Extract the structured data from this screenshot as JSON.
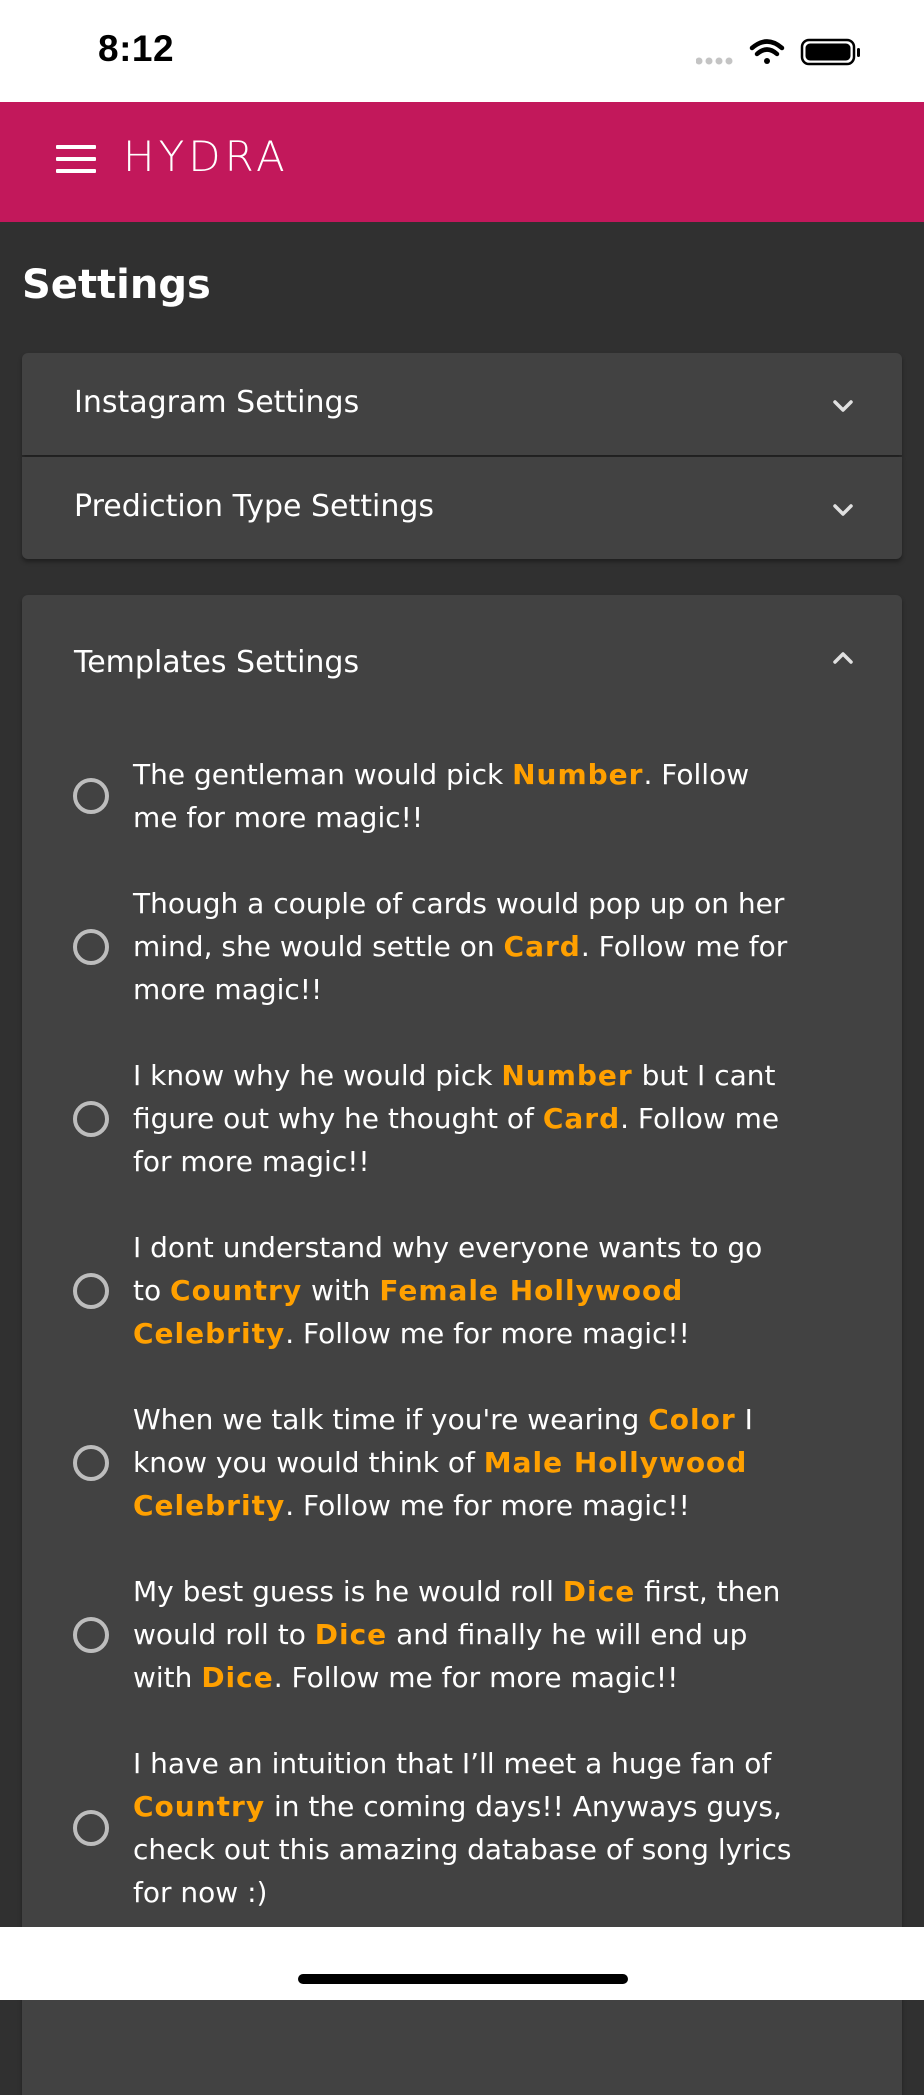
{
  "status_bar": {
    "time": "8:12",
    "icons": [
      "signal-dots-icon",
      "wifi-icon",
      "battery-icon"
    ]
  },
  "app_bar": {
    "menu_icon": "hamburger-menu-icon",
    "brand": "HYDRA",
    "color": "#c2185b"
  },
  "page": {
    "title": "Settings"
  },
  "panels": [
    {
      "title": "Instagram Settings",
      "expanded": false,
      "icon": "chevron-down-icon"
    },
    {
      "title": "Prediction Type Settings",
      "expanded": false,
      "icon": "chevron-down-icon"
    },
    {
      "title": "Templates Settings",
      "expanded": true,
      "icon": "chevron-up-icon"
    }
  ],
  "templates": [
    {
      "selected": false,
      "parts": [
        {
          "t": "The gentleman would pick "
        },
        {
          "t": "Number",
          "hl": true
        },
        {
          "t": ". Follow me for more magic!!"
        }
      ]
    },
    {
      "selected": false,
      "parts": [
        {
          "t": "Though a couple of cards would pop up on her mind, she would settle on "
        },
        {
          "t": "Card",
          "hl": true
        },
        {
          "t": ". Follow me for more magic!!"
        }
      ]
    },
    {
      "selected": false,
      "parts": [
        {
          "t": "I know why he would pick "
        },
        {
          "t": "Number",
          "hl": true
        },
        {
          "t": " but I cant figure out why he thought of "
        },
        {
          "t": "Card",
          "hl": true
        },
        {
          "t": ". Follow me for more magic!!"
        }
      ]
    },
    {
      "selected": false,
      "parts": [
        {
          "t": "I dont understand why everyone wants to go to "
        },
        {
          "t": "Country",
          "hl": true
        },
        {
          "t": " with "
        },
        {
          "t": "Female Hollywood Celebrity",
          "hl": true
        },
        {
          "t": ". Follow me for more magic!!"
        }
      ]
    },
    {
      "selected": false,
      "parts": [
        {
          "t": "When we talk time if you're wearing "
        },
        {
          "t": "Color",
          "hl": true
        },
        {
          "t": " I know you would think of "
        },
        {
          "t": "Male Hollywood Celebrity",
          "hl": true
        },
        {
          "t": ". Follow me for more magic!!"
        }
      ]
    },
    {
      "selected": false,
      "parts": [
        {
          "t": "My best guess is he would roll "
        },
        {
          "t": "Dice",
          "hl": true
        },
        {
          "t": " first, then would roll to "
        },
        {
          "t": "Dice",
          "hl": true
        },
        {
          "t": " and finally he will end up with "
        },
        {
          "t": "Dice",
          "hl": true
        },
        {
          "t": ". Follow me for more magic!!"
        }
      ]
    },
    {
      "selected": false,
      "parts": [
        {
          "t": "I have an intuition that I’ll meet a huge fan of "
        },
        {
          "t": "Country",
          "hl": true
        },
        {
          "t": " in the coming days!! Anyways guys, check out this amazing database of song lyrics for now :)"
        }
      ]
    }
  ],
  "colors": {
    "background": "#303030",
    "panel": "#424242",
    "highlight": "#ffa000",
    "radio": "#bdbdbd"
  }
}
